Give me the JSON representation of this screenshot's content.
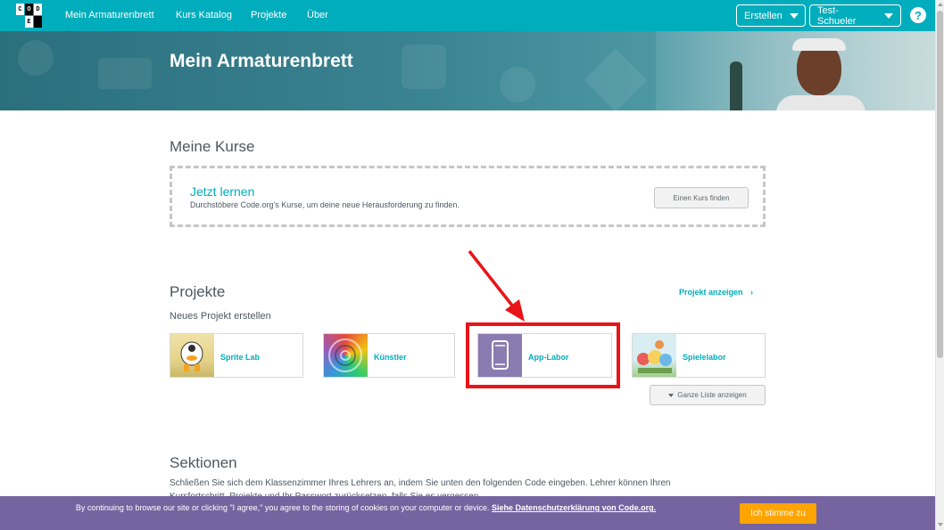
{
  "nav": {
    "logo_letters": [
      "C",
      "O",
      "D",
      "E"
    ],
    "links": [
      "Mein Armaturenbrett",
      "Kurs Katalog",
      "Projekte",
      "Über"
    ],
    "create_label": "Erstellen",
    "user_label": "Test-Schueler",
    "help_label": "?"
  },
  "banner": {
    "title": "Mein Armaturenbrett"
  },
  "courses": {
    "title": "Meine Kurse",
    "learn_title": "Jetzt lernen",
    "learn_desc": "Durchstöbere Code.org's Kurse, um deine neue Herausforderung zu finden.",
    "find_button": "Einen Kurs finden"
  },
  "projects": {
    "title": "Projekte",
    "show_link": "Projekt anzeigen",
    "new_label": "Neues Projekt erstellen",
    "cards": [
      {
        "label": "Sprite Lab",
        "icon": "sprite-lab-icon"
      },
      {
        "label": "Künstler",
        "icon": "artist-icon"
      },
      {
        "label": "App-Labor",
        "icon": "app-lab-icon"
      },
      {
        "label": "Spielelabor",
        "icon": "game-lab-icon"
      }
    ],
    "full_list_button": "Ganze Liste anzeigen"
  },
  "sections": {
    "title": "Sektionen",
    "desc": "Schließen Sie sich dem Klassenzimmer Ihres Lehrers an, indem Sie unten den folgenden Code eingeben. Lehrer können Ihren Kursfortschritt, Projekte und Ihr Passwort zurücksetzen, falls Sie es vergessen."
  },
  "cookie": {
    "text": "By continuing to browse our site or clicking \"I agree,\" you agree to the storing of cookies on your computer or device.",
    "link": "Siehe Datenschutzerklärung von Code.org.",
    "agree_button": "Ich stimme zu"
  },
  "colors": {
    "brand": "#00adbc",
    "highlight": "#e8141a",
    "cookie_bg": "#7664a0",
    "agree": "#ffa400"
  }
}
